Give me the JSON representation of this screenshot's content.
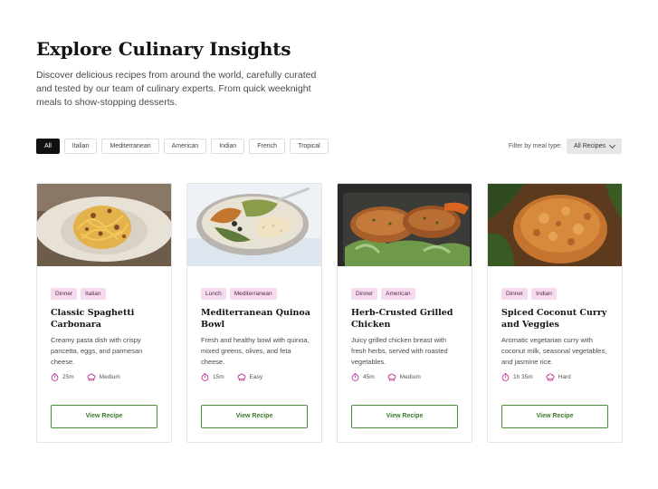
{
  "header": {
    "title": "Explore Culinary Insights",
    "intro": "Discover delicious recipes from around the world, carefully curated and tested by our team of culinary experts. From quick weeknight meals to show-stopping desserts."
  },
  "filters": {
    "chips": [
      "All",
      "Italian",
      "Mediterranean",
      "American",
      "Indian",
      "French",
      "Tropical"
    ],
    "active": "All",
    "meal_label": "Filter by meal type:",
    "meal_value": "All Recipes"
  },
  "recipes": [
    {
      "tags": [
        "Dinner",
        "Italian"
      ],
      "title": "Classic Spaghetti Carbonara",
      "description": "Creamy pasta dish with crispy pancetta, eggs, and parmesan cheese.",
      "time": "25m",
      "difficulty": "Medium",
      "button": "View Recipe"
    },
    {
      "tags": [
        "Lunch",
        "Mediterranean"
      ],
      "title": "Mediterranean Quinoa Bowl",
      "description": "Fresh and healthy bowl with quinoa, mixed greens, olives, and feta cheese.",
      "time": "15m",
      "difficulty": "Easy",
      "button": "View Recipe"
    },
    {
      "tags": [
        "Dinner",
        "American"
      ],
      "title": "Herb-Crusted Grilled Chicken",
      "description": "Juicy grilled chicken breast with fresh herbs, served with roasted vegetables.",
      "time": "45m",
      "difficulty": "Medium",
      "button": "View Recipe"
    },
    {
      "tags": [
        "Dinner",
        "Indian"
      ],
      "title": "Spiced Coconut Curry and Veggies",
      "description": "Aromatic vegetarian curry with coconut milk, seasonal vegetables, and jasmine rice.",
      "time": "1h 35m",
      "difficulty": "Hard",
      "button": "View Recipe"
    }
  ],
  "colors": {
    "accent_green": "#3b7a2b",
    "tag_bg": "#f6dbef",
    "icon_pink": "#c0399a",
    "active_chip": "#111111"
  },
  "icons": {
    "time": "timer-icon",
    "difficulty": "chef-hat-icon",
    "dropdown": "chevron-down-icon"
  }
}
